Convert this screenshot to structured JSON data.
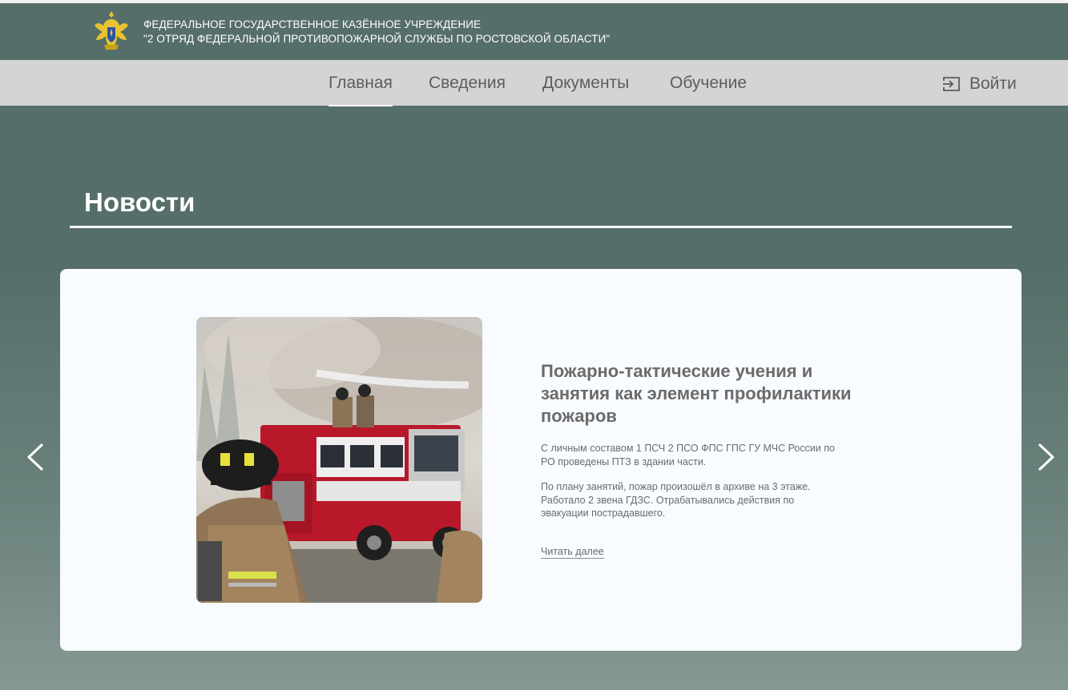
{
  "header": {
    "org_line1": "ФЕДЕРАЛЬНОЕ ГОСУДАРСТВЕННОЕ КАЗЁННОЕ УЧРЕЖДЕНИЕ",
    "org_line2": "\"2 ОТРЯД ФЕДЕРАЛЬНОЙ ПРОТИВОПОЖАРНОЙ СЛУЖБЫ ПО РОСТОВСКОЙ ОБЛАСТИ\"",
    "emblem_icon": "emchs-emblem-icon"
  },
  "nav": {
    "items": [
      {
        "label": "Главная",
        "active": true
      },
      {
        "label": "Сведения",
        "active": false
      },
      {
        "label": "Документы",
        "active": false
      },
      {
        "label": "Обучение",
        "active": false
      }
    ],
    "login_label": "Войти",
    "login_icon": "login-icon"
  },
  "news": {
    "section_title": "Новости",
    "current": {
      "title": "Пожарно-тактические учения и занятия как элемент профилактики пожаров",
      "paragraph1": "С личным составом 1 ПСЧ 2 ПСО ФПС ГПС ГУ МЧС России по РО проведены ПТЗ в здании части.",
      "paragraph2": "По плану занятий, пожар произошёл в архиве на 3 этаже. Работало 2 звена ГДЗС. Отрабатывались действия по эвакуации пострадавшего.",
      "read_more": "Читать далее",
      "image": "firefighters-fire-truck-photo"
    },
    "prev_icon": "chevron-left-icon",
    "next_icon": "chevron-right-icon"
  },
  "colors": {
    "header_bg": "#566e69",
    "nav_bg": "#d4d4d4",
    "card_bg": "#f8fbff",
    "text_gray": "#6b6b6b"
  }
}
